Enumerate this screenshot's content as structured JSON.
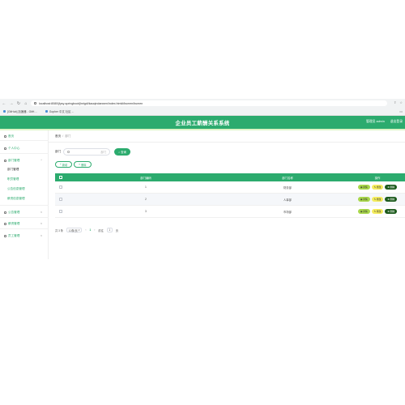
{
  "browser": {
    "url": "localhost:8080/jfysy-springboot/jinrigdi/kaoqindanwen/index.html#/bumen/bumen",
    "bookmarks": [
      "[GitHub] 加速器 - GitH…",
      "Gopher 中文 社区 ..."
    ],
    "icons": {
      "back": "back-arrow-icon",
      "forward": "forward-arrow-icon",
      "reload": "reload-icon",
      "home": "home-icon"
    }
  },
  "header": {
    "title": "企业员工薪酬关系系统",
    "user_label": "管理员 admin",
    "logout_label": "退出登录"
  },
  "sidebar": {
    "home": "首页",
    "personal": "个人中心",
    "dept_group": "部门管理",
    "dept_sub": "部门管理",
    "emp_group": "职员管理",
    "items_sub": [
      "职员管理",
      "公告信息管理",
      "薪资信息管理"
    ],
    "notice": "公告管理",
    "salary": "薪资管理",
    "employee": "员工管理"
  },
  "breadcrumb": {
    "home": "首页",
    "sep": "/",
    "current": "部门"
  },
  "search": {
    "label": "部门",
    "placeholder": "部门",
    "button": "查询"
  },
  "actions": {
    "add": "新增",
    "delete": "删除"
  },
  "table": {
    "columns": {
      "id": "部门编码",
      "name": "部门名称",
      "op": "操作"
    },
    "rows": [
      {
        "id": "1",
        "name": "财务部"
      },
      {
        "id": "2",
        "name": "人事部"
      },
      {
        "id": "3",
        "name": "市场部"
      }
    ],
    "ops": {
      "view": "详情",
      "edit": "修改",
      "del": "删除"
    }
  },
  "pager": {
    "total": "共 3 条",
    "size": "10条/页",
    "page": "1",
    "goto": "前往",
    "goto_value": "1",
    "page_unit": "页"
  },
  "colors": {
    "primary": "#2cab6e",
    "view": "#a8d74a",
    "edit": "#f4ec5c",
    "del": "#1c5a1c"
  }
}
